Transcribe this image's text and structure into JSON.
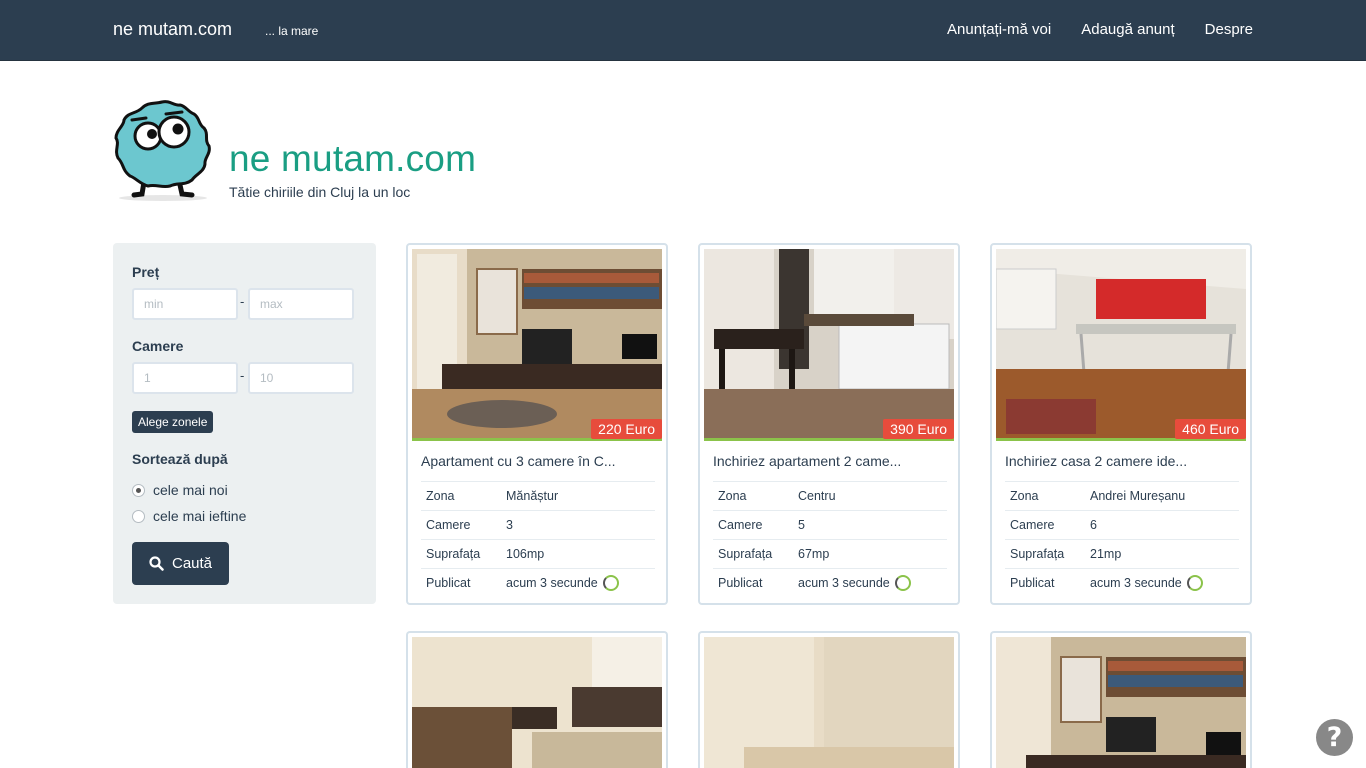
{
  "nav": {
    "brand": "ne mutam.com",
    "tagline": "... la mare",
    "links": [
      "Anunțați-mă voi",
      "Adaugă anunț",
      "Despre"
    ]
  },
  "hero": {
    "title": "ne mutam.com",
    "subtitle": "Tătie chiriile din Cluj la un loc"
  },
  "filter": {
    "price_label": "Preț",
    "price_min_placeholder": "min",
    "price_max_placeholder": "max",
    "rooms_label": "Camere",
    "rooms_min_placeholder": "1",
    "rooms_max_placeholder": "10",
    "dash": "-",
    "zones_button": "Alege zonele",
    "sort_label": "Sortează după",
    "sort_options": [
      {
        "label": "cele mai noi",
        "selected": true
      },
      {
        "label": "cele mai ieftine",
        "selected": false
      }
    ],
    "search_button": "Caută"
  },
  "listing_labels": {
    "zone": "Zona",
    "rooms": "Camere",
    "area": "Suprafața",
    "published": "Publicat"
  },
  "listings": [
    {
      "title": "Apartament cu 3 camere în C...",
      "price": "220 Euro",
      "zone": "Mănăștur",
      "rooms": "3",
      "area": "106mp",
      "published": "acum 3 secunde"
    },
    {
      "title": "Inchiriez apartament 2 came...",
      "price": "390 Euro",
      "zone": "Centru",
      "rooms": "5",
      "area": "67mp",
      "published": "acum 3 secunde"
    },
    {
      "title": "Inchiriez casa 2 camere ide...",
      "price": "460 Euro",
      "zone": "Andrei Mureșanu",
      "rooms": "6",
      "area": "21mp",
      "published": "acum 3 secunde"
    }
  ],
  "help_icon": "question-icon",
  "colors": {
    "navbar": "#2c3e50",
    "accent": "#1a9e83",
    "price": "#e74c3c",
    "bar": "#8bc34a"
  }
}
